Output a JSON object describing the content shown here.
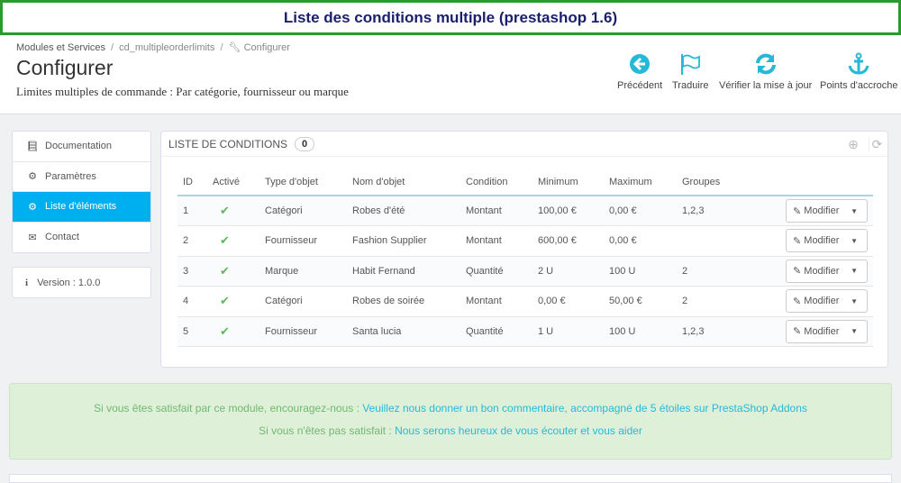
{
  "banner": "Liste des conditions multiple (prestashop 1.6)",
  "breadcrumb": [
    "Modules et Services",
    "cd_multipleorderlimits",
    "Configurer"
  ],
  "title": "Configurer",
  "subtitle": "Limites multiples de commande : Par catégorie, fournisseur ou marque",
  "toolbar": [
    {
      "label": "Précédent",
      "icon": "back-circle-icon"
    },
    {
      "label": "Traduire",
      "icon": "flag-icon"
    },
    {
      "label": "Vérifier la mise à jour",
      "icon": "refresh-icon"
    },
    {
      "label": "Points d'accroche",
      "icon": "anchor-icon"
    }
  ],
  "sidebar": {
    "items": [
      {
        "label": "Documentation",
        "icon": "book-icon"
      },
      {
        "label": "Paramètres",
        "icon": "cogs-icon"
      },
      {
        "label": "Liste d'éléments",
        "icon": "cogs-icon",
        "active": true
      },
      {
        "label": "Contact",
        "icon": "envelope-icon"
      }
    ],
    "version": "Version : 1.0.0"
  },
  "panel": {
    "title": "LISTE DE CONDITIONS",
    "count": "0",
    "columns": [
      "ID",
      "Activé",
      "Type d'objet",
      "Nom d'objet",
      "Condition",
      "Minimum",
      "Maximum",
      "Groupes"
    ],
    "rows": [
      [
        "1",
        "✔",
        "Catégori",
        "Robes d'été",
        "Montant",
        "100,00 €",
        "0,00 €",
        "1,2,3"
      ],
      [
        "2",
        "✔",
        "Fournisseur",
        "Fashion Supplier",
        "Montant",
        "600,00 €",
        "0,00 €",
        ""
      ],
      [
        "3",
        "✔",
        "Marque",
        "Habit Fernand",
        "Quantité",
        "2 U",
        "100 U",
        "2"
      ],
      [
        "4",
        "✔",
        "Catégori",
        "Robes de soirée",
        "Montant",
        "0,00 €",
        "50,00 €",
        "2"
      ],
      [
        "5",
        "✔",
        "Fournisseur",
        "Santa lucia",
        "Quantité",
        "1 U",
        "100 U",
        "1,2,3"
      ]
    ],
    "edit_label": "Modifier"
  },
  "alert": {
    "line1_text": "Si vous êtes satisfait par ce module, encouragez-nous : ",
    "line1_link": "Veuillez nous donner un bon commentaire, accompagné de 5 étoiles sur PrestaShop Addons",
    "line2_text": "Si vous n'êtes pas satisfait : ",
    "line2_link": "Nous serons heureux de vous écouter et vous aider"
  },
  "colors": {
    "accent": "#25b9d7",
    "active": "#00aff0",
    "success": "#dff0d8"
  }
}
